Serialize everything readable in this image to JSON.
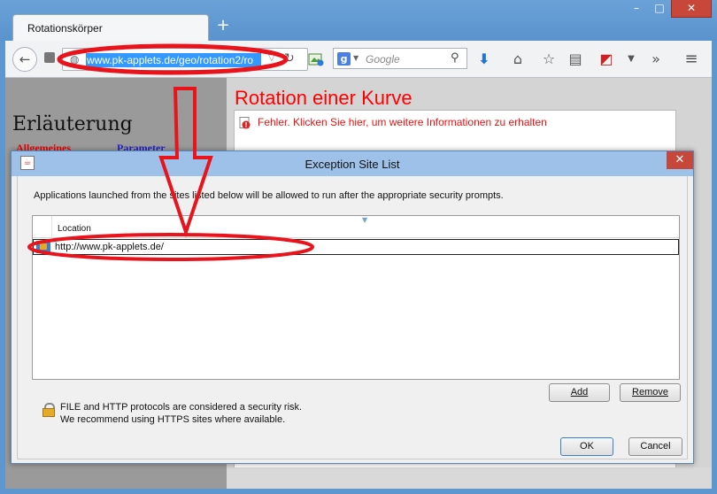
{
  "browser": {
    "tab_title": "Rotationskörper",
    "new_tab": "+",
    "window_controls": {
      "minimize": "–",
      "maximize": "□",
      "close": "✕"
    },
    "url": "www.pk-applets.de/geo/rotation2/ro",
    "search_placeholder": "Google",
    "icons": [
      "back-icon",
      "history-icon",
      "globe-icon",
      "reload-icon",
      "green-addon-icon",
      "google-icon",
      "search-icon",
      "download-icon",
      "home-icon",
      "star-icon",
      "reader-icon",
      "addon-icon",
      "more-icon",
      "menu-icon"
    ]
  },
  "page": {
    "left_heading": "Erläuterung",
    "tab_allgemeines": "Allgemeines",
    "tab_parameter": "Parameter",
    "title": "Rotation einer Kurve",
    "error_text": "Fehler. Klicken Sie hier, um weitere Informationen zu erhalten"
  },
  "dialog": {
    "title": "Exception Site List",
    "close": "✕",
    "description": "Applications launched from the sites listed below will be allowed to run after the appropriate security prompts.",
    "columns": [
      "Location"
    ],
    "rows": [
      "http://www.pk-applets.de/"
    ],
    "add_label": "Add",
    "remove_label": "Remove",
    "warning_line1": "FILE and HTTP protocols are considered a security risk.",
    "warning_line2": "We recommend using HTTPS sites where available.",
    "ok_label": "OK",
    "cancel_label": "Cancel"
  },
  "colors": {
    "annotation_red": "#e8131b",
    "url_highlight": "#3399ff",
    "close_red": "#c7473b",
    "title_red": "#ff0000"
  }
}
